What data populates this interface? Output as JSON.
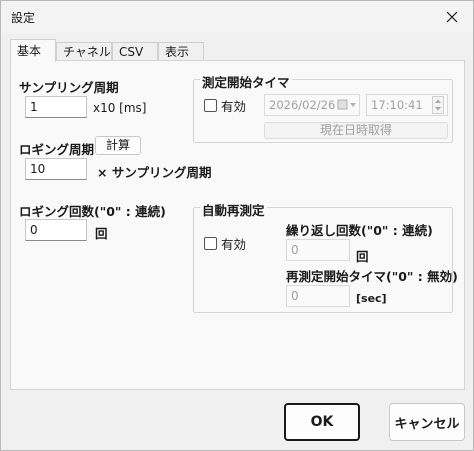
{
  "window": {
    "title": "設定"
  },
  "tabs": [
    {
      "label": "基本"
    },
    {
      "label": "チャネル"
    },
    {
      "label": "CSV"
    },
    {
      "label": "表示"
    }
  ],
  "basic": {
    "sampling_label": "サンプリング周期",
    "sampling_value": "1",
    "sampling_unit": "x10 [ms]",
    "logging_label": "ロギング周期",
    "calc_button": "計算",
    "logging_value": "10",
    "logging_unit": "× サンプリング周期",
    "count_label": "ロギング回数(\"0\" : 連続)",
    "count_value": "0",
    "count_unit": "回"
  },
  "start_timer": {
    "title": "測定開始タイマ",
    "enable_label": "有効",
    "date_value": "2026/02/26",
    "time_value": "17:10:41",
    "now_button": "現在日時取得"
  },
  "auto_remeasure": {
    "title": "自動再測定",
    "enable_label": "有効",
    "repeat_label": "繰り返し回数(\"0\" : 連続)",
    "repeat_value": "0",
    "repeat_unit": "回",
    "restart_label": "再測定開始タイマ(\"0\" : 無効)",
    "restart_value": "0",
    "restart_unit": "[sec]"
  },
  "footer": {
    "ok_label": "OK",
    "cancel_label": "キャンセル"
  }
}
